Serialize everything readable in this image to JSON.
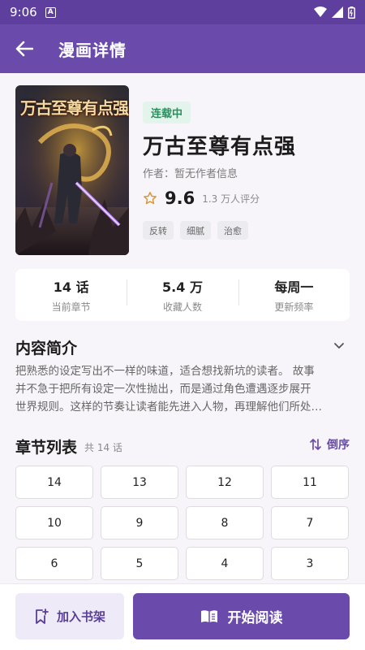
{
  "status_bar": {
    "time": "9:06",
    "notification_icon": "A"
  },
  "app_bar": {
    "title": "漫画详情"
  },
  "book": {
    "cover_title": "万古至尊有点强",
    "status_badge": "连载中",
    "title": "万古至尊有点强",
    "author": "作者：暂无作者信息",
    "score": "9.6",
    "rating_count": "1.3 万人评分",
    "tags": [
      "反转",
      "细腻",
      "治愈"
    ]
  },
  "stats": [
    {
      "value": "14 话",
      "label": "当前章节"
    },
    {
      "value": "5.4 万",
      "label": "收藏人数"
    },
    {
      "value": "每周一",
      "label": "更新频率"
    }
  ],
  "synopsis": {
    "heading": "内容简介",
    "lines": [
      "把熟悉的设定写出不一样的味道，适合想找新坑的读者。 故事",
      "并不急于把所有设定一次性抛出，而是通过角色遭遇逐步展开",
      "世界规则。这样的节奏让读者能先进入人物，再理解他们所处…"
    ]
  },
  "chapters": {
    "heading": "章节列表",
    "count": "共 14 话",
    "sort_label": "倒序",
    "items": [
      "14",
      "13",
      "12",
      "11",
      "10",
      "9",
      "8",
      "7",
      "6",
      "5",
      "4",
      "3"
    ]
  },
  "bottom": {
    "shelf_label": "加入书架",
    "read_label": "开始阅读"
  },
  "colors": {
    "primary": "#6a4aab",
    "status_bar": "#5e3f9e",
    "badge_green": "#2e8c5f",
    "star": "#d49a3a"
  }
}
